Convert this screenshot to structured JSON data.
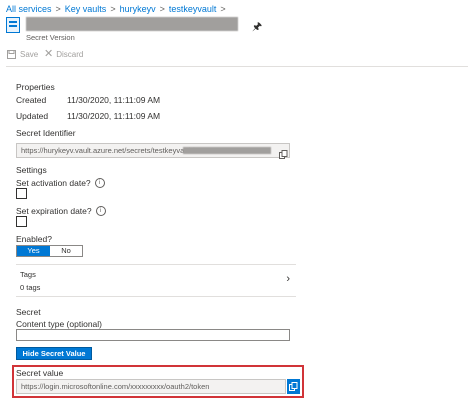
{
  "breadcrumb": {
    "items": [
      "All services",
      "Key vaults",
      "hurykeyv",
      "testkeyvault"
    ],
    "separator": ">"
  },
  "header": {
    "subtitle": "Secret Version"
  },
  "toolbar": {
    "save_label": "Save",
    "discard_label": "Discard"
  },
  "properties": {
    "heading": "Properties",
    "created_label": "Created",
    "created_value": "11/30/2020, 11:11:09 AM",
    "updated_label": "Updated",
    "updated_value": "11/30/2020, 11:11:09 AM"
  },
  "identifier": {
    "label": "Secret Identifier",
    "value": "https://hurykeyv.vault.azure.net/secrets/testkeyvault/"
  },
  "settings": {
    "heading": "Settings",
    "activation_label": "Set activation date?",
    "expiration_label": "Set expiration date?",
    "enabled_label": "Enabled?",
    "enabled_yes": "Yes",
    "enabled_no": "No",
    "enabled_selected": "Yes"
  },
  "tags": {
    "label": "Tags",
    "count": "0 tags"
  },
  "secret": {
    "heading": "Secret",
    "content_type_label": "Content type (optional)",
    "content_type_value": "",
    "hide_button_label": "Hide Secret Value",
    "value_label": "Secret value",
    "value": "https://login.microsoftonline.com/xxxxxxxxx/oauth2/token"
  },
  "colors": {
    "accent": "#0078d4",
    "highlight_border": "#d13438"
  }
}
